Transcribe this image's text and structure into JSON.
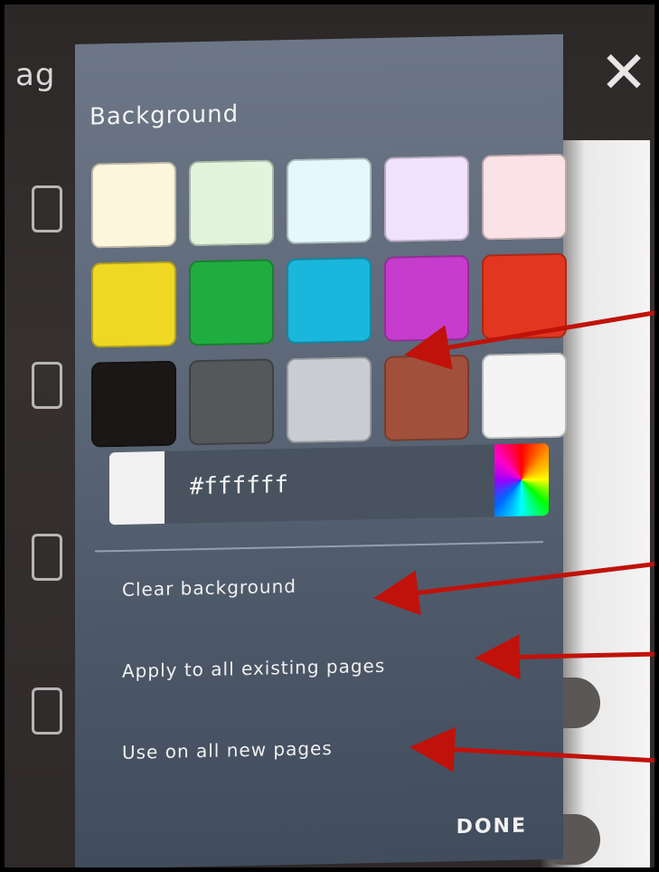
{
  "background_screen": {
    "left_text": "ag",
    "close_glyph": "✕"
  },
  "panel": {
    "title": "Background",
    "swatches": [
      {
        "name": "light-yellow",
        "color": "#fbf6dc"
      },
      {
        "name": "light-green",
        "color": "#e2f4dc"
      },
      {
        "name": "light-cyan",
        "color": "#e4f9fb"
      },
      {
        "name": "light-violet",
        "color": "#f1e2fb"
      },
      {
        "name": "light-pink",
        "color": "#fbe2e6"
      },
      {
        "name": "yellow",
        "color": "#efd724"
      },
      {
        "name": "green",
        "color": "#1fad3f"
      },
      {
        "name": "cyan",
        "color": "#19b7dc"
      },
      {
        "name": "magenta",
        "color": "#c63ccc"
      },
      {
        "name": "red",
        "color": "#e33620"
      },
      {
        "name": "black",
        "color": "#1b1716"
      },
      {
        "name": "dark-gray",
        "color": "#56575a"
      },
      {
        "name": "light-gray",
        "color": "#c9cdd2"
      },
      {
        "name": "brown",
        "color": "#a1513b"
      },
      {
        "name": "white",
        "color": "#f4f4f4"
      }
    ],
    "custom_color": {
      "value": "#ffffff",
      "preview_color": "#f1f1f1"
    },
    "menu": {
      "clear": "Clear background",
      "apply_existing": "Apply to all existing pages",
      "use_new": "Use on all new pages"
    },
    "done_label": "DONE"
  },
  "annotation_color": "#c0120a"
}
